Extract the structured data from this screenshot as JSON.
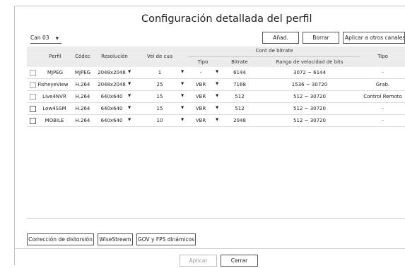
{
  "title": "Configuración detallada del perfil",
  "channel": {
    "value": "Can 03",
    "arrow": "▼"
  },
  "toolbar": {
    "add_label": "Añad.",
    "delete_label": "Borrar",
    "apply_label": "Aplicar a otros canales"
  },
  "table": {
    "headers": {
      "perfil": "Perfil",
      "codec": "Códec",
      "resolucion": "Resolución",
      "vel": "Vel de cua",
      "cont": "Cont de bitrate",
      "tipo": "Tipo",
      "bitrate": "Bitrate",
      "rango": "Rango de velocidad de bits",
      "tipo2": "Tipo"
    },
    "dropdown_arrow": "▼",
    "rows": [
      {
        "perfil": "MJPEG",
        "codec": "MJPEG",
        "resolucion": "2048x2048",
        "vel": "1",
        "tipo": "-",
        "bitrate": "6144",
        "rango": "3072 ~ 6144",
        "tipo2": "-"
      },
      {
        "perfil": "FisheyeView",
        "codec": "H.264",
        "resolucion": "2048x2048",
        "vel": "25",
        "tipo": "VBR",
        "bitrate": "7168",
        "rango": "1536 ~ 30720",
        "tipo2": "Grab."
      },
      {
        "perfil": "Live4NVR",
        "codec": "H.264",
        "resolucion": "640x640",
        "vel": "15",
        "tipo": "VBR",
        "bitrate": "512",
        "rango": "512 ~ 30720",
        "tipo2": "Control Remoto"
      },
      {
        "perfil": "Low4SSM",
        "codec": "H.264",
        "resolucion": "640x640",
        "vel": "15",
        "tipo": "VBR",
        "bitrate": "512",
        "rango": "512 ~ 30720",
        "tipo2": "-"
      },
      {
        "perfil": "MOBILE",
        "codec": "H.264",
        "resolucion": "640x640",
        "vel": "10",
        "tipo": "VBR",
        "bitrate": "2048",
        "rango": "512 ~ 30720",
        "tipo2": "-"
      }
    ]
  },
  "bottom_buttons": {
    "distortion_label": "Corrección de distorsión",
    "wisestream_label": "WiseStream",
    "gov_label": "GOV y FPS dinámicos"
  },
  "footer": {
    "apply_label": "Aplicar",
    "close_label": "Cerrar"
  }
}
